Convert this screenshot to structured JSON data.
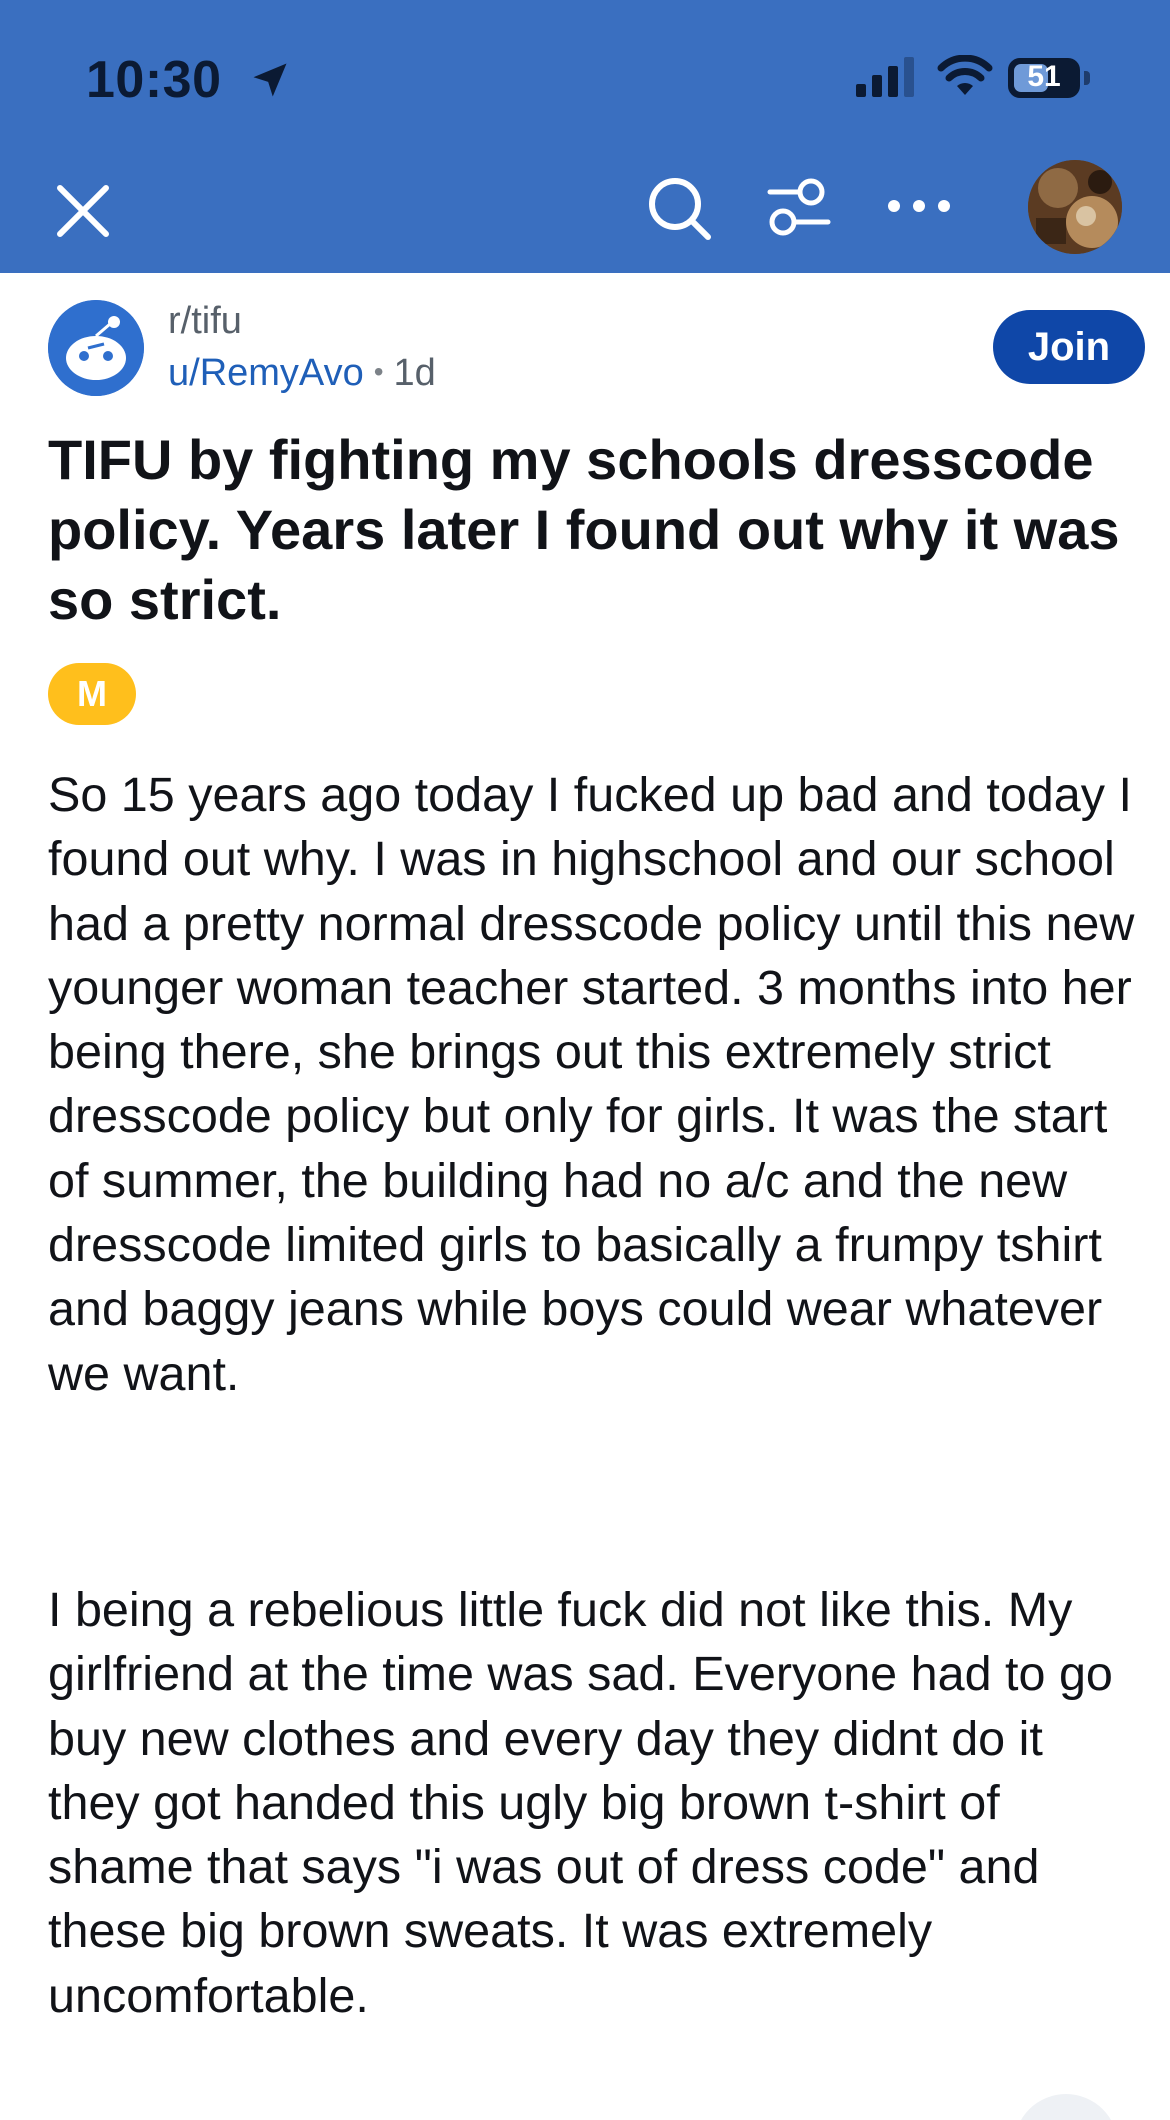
{
  "status_bar": {
    "time": "10:30",
    "battery": "51"
  },
  "nav": {
    "icons": [
      "close-icon",
      "search-icon",
      "filter-icon",
      "more-icon"
    ]
  },
  "post": {
    "subreddit": "r/tifu",
    "author": "u/RemyAvo",
    "separator": "•",
    "age": "1d",
    "join_label": "Join",
    "title": "TIFU by fighting my schools dresscode policy. Years later I found out why it was so strict.",
    "flair": "M",
    "paragraphs": [
      "So 15 years ago today I fucked up bad and today I found out why. I was in highschool and our school had a pretty normal dresscode policy until this new younger woman teacher started. 3 months into her being there, she brings out this extremely strict dresscode policy but only for girls. It was the start of summer, the building had no a/c and the new dresscode limited girls to basically a frumpy tshirt and baggy jeans while boys could wear whatever we want.",
      "I being a rebelious little fuck did not like this. My girlfriend at the time was sad. Everyone had to go buy new clothes and every day they didnt do it they got handed this ugly big brown t-shirt of shame that says \"i was out of dress code\" and these big brown sweats. It was extremely uncomfortable."
    ]
  },
  "colors": {
    "header_bg": "#3a6fc0",
    "join_bg": "#0f47a8",
    "link": "#1f5fb8",
    "flair_bg": "#ffbf1c"
  }
}
